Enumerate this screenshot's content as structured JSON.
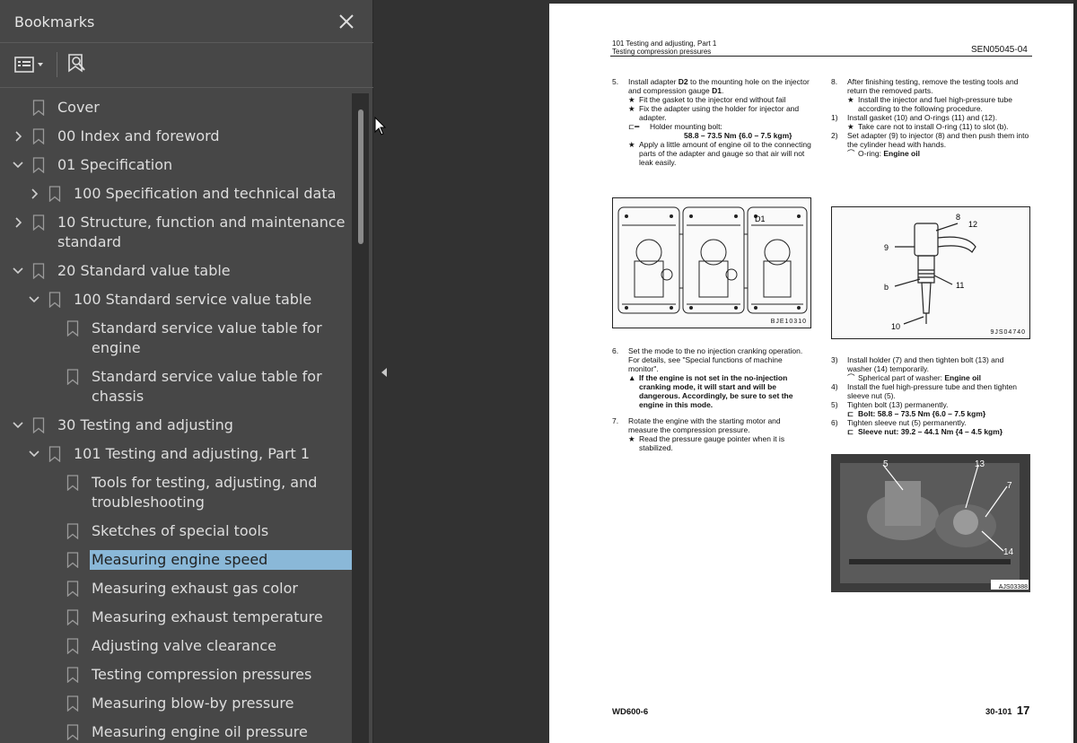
{
  "sidebar": {
    "title": "Bookmarks",
    "close_icon": "close-icon",
    "toolbar": {
      "options_icon": "options-list-icon",
      "find_icon": "find-bookmark-icon"
    },
    "items": [
      {
        "label": "Cover",
        "level": 0,
        "chevron": "none",
        "selected": false
      },
      {
        "label": "00 Index and foreword",
        "level": 0,
        "chevron": "right",
        "selected": false
      },
      {
        "label": "01 Specification",
        "level": 0,
        "chevron": "down",
        "selected": false
      },
      {
        "label": "100 Specification and technical data",
        "level": 1,
        "chevron": "right",
        "selected": false
      },
      {
        "label": "10 Structure, function and maintenance standard",
        "level": 0,
        "chevron": "right",
        "selected": false
      },
      {
        "label": "20 Standard value table",
        "level": 0,
        "chevron": "down",
        "selected": false
      },
      {
        "label": "100 Standard service value table",
        "level": 1,
        "chevron": "down",
        "selected": false
      },
      {
        "label": "Standard service value table for engine",
        "level": 2,
        "chevron": "none",
        "selected": false
      },
      {
        "label": "Standard service value table for chassis",
        "level": 2,
        "chevron": "none",
        "selected": false
      },
      {
        "label": "30 Testing and adjusting",
        "level": 0,
        "chevron": "down",
        "selected": false
      },
      {
        "label": "101 Testing and adjusting, Part 1",
        "level": 1,
        "chevron": "down",
        "selected": false
      },
      {
        "label": "Tools for testing, adjusting, and troubleshooting",
        "level": 2,
        "chevron": "none",
        "selected": false
      },
      {
        "label": "Sketches of special tools",
        "level": 2,
        "chevron": "none",
        "selected": false
      },
      {
        "label": "Measuring engine speed",
        "level": 2,
        "chevron": "none",
        "selected": true
      },
      {
        "label": "Measuring exhaust gas color",
        "level": 2,
        "chevron": "none",
        "selected": false
      },
      {
        "label": "Measuring exhaust temperature",
        "level": 2,
        "chevron": "none",
        "selected": false
      },
      {
        "label": "Adjusting valve clearance",
        "level": 2,
        "chevron": "none",
        "selected": false
      },
      {
        "label": "Testing compression pressures",
        "level": 2,
        "chevron": "none",
        "selected": false
      },
      {
        "label": "Measuring blow-by pressure",
        "level": 2,
        "chevron": "none",
        "selected": false
      },
      {
        "label": "Measuring engine oil pressure",
        "level": 2,
        "chevron": "none",
        "selected": false
      }
    ],
    "selection_color": "#8ab8d8"
  },
  "page": {
    "header_left_1": "101 Testing and adjusting, Part 1",
    "header_left_2": "Testing compression pressures",
    "header_right": "SEN05045-04",
    "left": {
      "step5_num": "5.",
      "step5_pre": "Install adapter ",
      "step5_d2": "D2",
      "step5_mid": " to the mounting hole on the injector and compression gauge ",
      "step5_d1": "D1",
      "step5_end": ".",
      "s5_b1": "Fit the gasket to the injector end without fail",
      "s5_b2": "Fix the adapter using the holder for injector and adapter.",
      "s5_torque_label": "Holder mounting bolt:",
      "s5_torque_value": "58.8 – 73.5 Nm {6.0 – 7.5 kgm}",
      "s5_b3": "Apply a little amount of engine oil to the connecting parts of the adapter and gauge so that air will not leak easily.",
      "fig1_code": "BJE10310",
      "fig1_label": "D1",
      "step6_num": "6.",
      "step6": "Set the mode to the no injection cranking operation. For details, see \"Special functions of machine monitor\".",
      "step6_warn": "If the engine is not set in the no-injection cranking mode, it will start and will be dangerous. Accordingly, be sure to set the engine in this mode.",
      "step7_num": "7.",
      "step7": "Rotate the engine with the starting motor and measure the compression pressure.",
      "s7_b1": "Read the pressure gauge pointer when it is stabilized."
    },
    "right": {
      "step8_num": "8.",
      "step8": "After finishing testing, remove the testing tools and return the removed parts.",
      "s8_b1": "Install the injector and fuel high-pressure tube according to the following procedure.",
      "s8_1_num": "1)",
      "s8_1": "Install gasket (10) and O-rings (11) and (12).",
      "s8_1_b": "Take care not to install O-ring (11) to slot (b).",
      "s8_2_num": "2)",
      "s8_2": "Set adapter (9) to injector (8) and then push them into the cylinder head with hands.",
      "s8_2_oil_pre": "O-ring: ",
      "s8_2_oil": "Engine oil",
      "fig2_code": "9JS04740",
      "fig2_labels": [
        "8",
        "12",
        "9",
        "b",
        "11",
        "10"
      ],
      "s8_3_num": "3)",
      "s8_3": "Install holder (7) and then tighten bolt (13) and washer (14) temporarily.",
      "s8_3_oil_pre": "Spherical part of washer: ",
      "s8_3_oil": "Engine oil",
      "s8_4_num": "4)",
      "s8_4": "Install the fuel high-pressure tube and then tighten sleeve nut (5).",
      "s8_5_num": "5)",
      "s8_5": "Tighten bolt (13) permanently.",
      "s8_5_torque": "Bolt: 58.8 – 73.5 Nm {6.0 – 7.5 kgm}",
      "s8_6_num": "6)",
      "s8_6": "Tighten sleeve nut (5) permanently.",
      "s8_6_torque": "Sleeve nut: 39.2 – 44.1 Nm {4 – 4.5 kgm}",
      "photo_code": "AJS03388",
      "photo_labels": [
        "5",
        "13",
        "7",
        "14"
      ]
    },
    "footer_left": "WD600-6",
    "footer_right_section": "30-101",
    "footer_right_page": "17"
  }
}
